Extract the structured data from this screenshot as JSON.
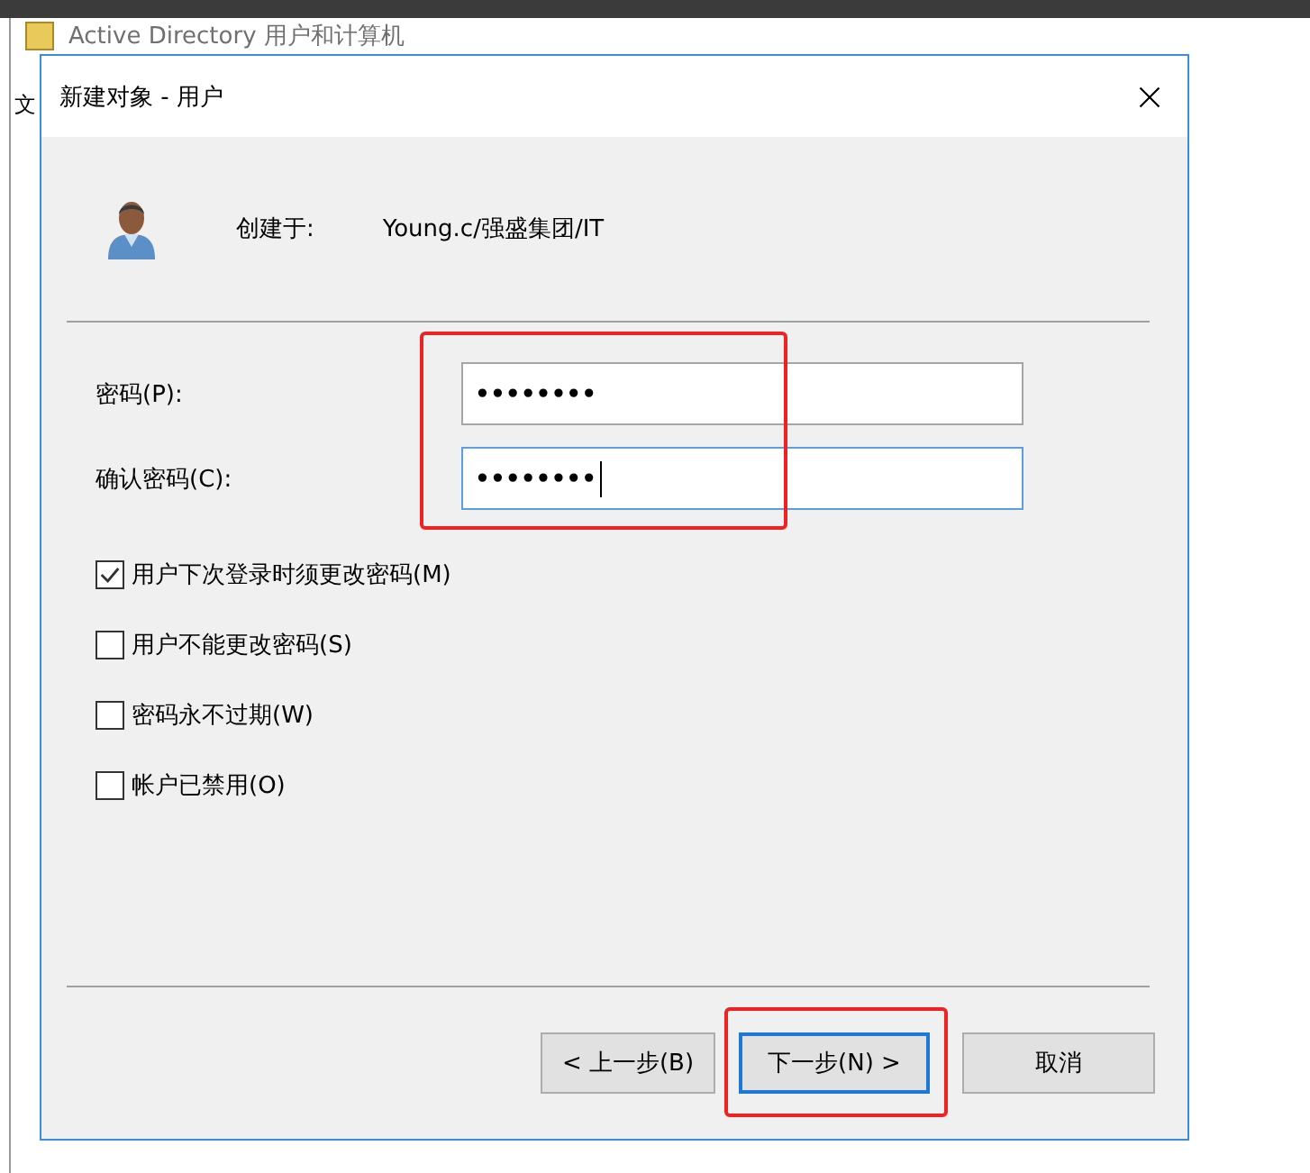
{
  "background_window": {
    "title": "Active Directory 用户和计算机",
    "menu": [
      "文"
    ]
  },
  "dialog": {
    "title": "新建对象 - 用户",
    "created_in_label": "创建于:",
    "created_in_value": "Young.c/强盛集团/IT",
    "fields": [
      {
        "label": "密码(P):",
        "value": "••••••••",
        "focused": false
      },
      {
        "label": "确认密码(C):",
        "value": "••••••••",
        "focused": true
      }
    ],
    "options": [
      {
        "label": "用户下次登录时须更改密码(M)",
        "checked": true
      },
      {
        "label": "用户不能更改密码(S)",
        "checked": false
      },
      {
        "label": "密码永不过期(W)",
        "checked": false
      },
      {
        "label": "帐户已禁用(O)",
        "checked": false
      }
    ],
    "buttons": [
      {
        "label": "< 上一步(B)",
        "default": false
      },
      {
        "label": "下一步(N) >",
        "default": true
      },
      {
        "label": "取消",
        "default": false
      }
    ]
  }
}
